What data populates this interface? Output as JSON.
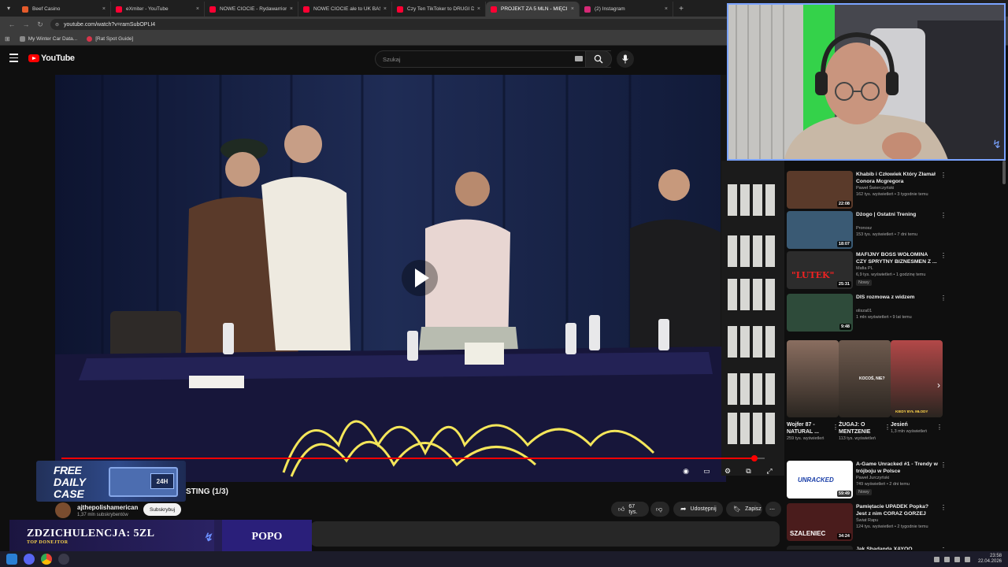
{
  "browser": {
    "tabs": [
      {
        "title": "Beef Casino",
        "color": "#e55b2b",
        "active": false
      },
      {
        "title": "eXmiter - YouTube",
        "color": "#ff0033",
        "active": false
      },
      {
        "title": "NOWE CIOCIE - Rydawarrior (y...",
        "color": "#ff0033",
        "active": false
      },
      {
        "title": "NOWE CIOCIE ale to UK BASS!...",
        "color": "#ff0033",
        "active": false
      },
      {
        "title": "Czy Ten TikToker to DRUGI Dan...",
        "color": "#ff0033",
        "active": false
      },
      {
        "title": "PROJEKT ZA 5 MLN - MIĘCI...",
        "color": "#ff0033",
        "active": true
      },
      {
        "title": "(2) Instagram",
        "color": "#d62976",
        "active": false
      }
    ],
    "close_glyph": "×",
    "newtab_glyph": "+",
    "url": "youtube.com/watch?v=ramSubOPLI4",
    "bookmarks": [
      {
        "label": "My Winter Car Data...",
        "color": "#8a8a8a"
      },
      {
        "label": "[Rat Spot Guide]",
        "color": "#d8344a"
      }
    ]
  },
  "youtube": {
    "logo_text": "YouTube",
    "search_placeholder": "Szukaj",
    "video": {
      "title_partial": "STING (1/3)",
      "progress": 0.985,
      "channel_name": "ajthepolishamerican",
      "channel_subs": "1,37 mln subskrybentów",
      "subscribe_label": "Subskrybuj",
      "likes": "67 tys.",
      "share_label": "Udostępnij",
      "save_label": "Zapisz",
      "more_glyph": "⋯"
    },
    "recommendations": [
      {
        "title": "Khabib i Człowiek Który Złamał Conora Mcgregora",
        "channel": "Paweł Świerczyński",
        "meta": "162 tys. wyświetleń • 3 tygodnie temu",
        "duration": "22:08",
        "new": false,
        "thumb_color": "#5a3a2a"
      },
      {
        "title": "Dżogo | Ostatni Trening",
        "channel": "Pronosz",
        "meta": "153 tys. wyświetleń • 7 dni temu",
        "duration": "18:07",
        "new": false,
        "thumb_color": "#3a5a74"
      },
      {
        "title": "MAFIJNY BOSS WOŁOMINA CZY SPRYTNY BIZNESMEN Z ...",
        "channel": "Mafia PL",
        "meta": "6,9 tys. wyświetleń • 1 godzinę temu",
        "duration": "25:31",
        "new": true,
        "thumb_color": "#2c2c2c"
      },
      {
        "title": "DIS rozmowa z widzem",
        "channel": "olisza01",
        "meta": "1 mln wyświetleń • 9 lat temu",
        "duration": "9:48",
        "new": false,
        "thumb_color": "#2e4b3a"
      }
    ],
    "new_badge": "Nowy",
    "thumb_texts": {
      "luter": "\"LUTEK\"",
      "unracked": "UNRACKED",
      "szaleniec": "SZALENIEC",
      "kocos": "KOCOŚ, NIE?",
      "kiedy": "KIEDY BYŁ MŁODY"
    },
    "shorts": [
      {
        "title": "Wojfer 87 - NATURAL ...",
        "views": "259 tys. wyświetleń",
        "color": "#8a6e60"
      },
      {
        "title": "ŻUGAJ: O MENTZENIE",
        "views": "113 tys. wyświetleń",
        "color": "#6e5a4e"
      },
      {
        "title": "Jesień",
        "views": "1,3 mln wyświetleń",
        "color": "#b34848"
      }
    ],
    "shorts_next": "›",
    "more_recommendations": [
      {
        "title": "A-Game Unracked #1 - Trendy w trójboju w Polsce",
        "channel": "Paweł Jurczyński",
        "meta": "749 wyświetleń • 2 dni temu",
        "duration": "59:49",
        "new": true,
        "thumb_color": "#ffffff"
      },
      {
        "title": "Pamiętacie UPADEK Popka? Jest z nim CORAZ GORZEJ",
        "channel": "Świat Rapu",
        "meta": "124 tys. wyświetleń • 2 tygodnie temu",
        "duration": "34:24",
        "new": false,
        "thumb_color": "#4a1c1c"
      },
      {
        "title": "Jak Shadanda XAYOO...",
        "channel": "",
        "meta": "",
        "duration": "",
        "new": false,
        "thumb_color": "#222222"
      }
    ]
  },
  "overlays": {
    "free_case": [
      "FREE",
      "DAILY",
      "CASE"
    ],
    "free_case_badge": "24H",
    "donate_amount": "ZDZICHULENCJA: 5ZL",
    "donate_subtitle": "TOP DONEJTOR",
    "donate_mark": "↯",
    "donate_right": "POPO"
  },
  "taskbar": {
    "time": "23:58",
    "date": "22.04.2026"
  },
  "icons": {
    "menu": "hamburger-icon",
    "search": "search-icon",
    "mic": "microphone-icon",
    "play": "play-icon",
    "like": "thumbs-up-icon",
    "dislike": "thumbs-down-icon",
    "share": "share-icon",
    "save": "bookmark-icon"
  }
}
